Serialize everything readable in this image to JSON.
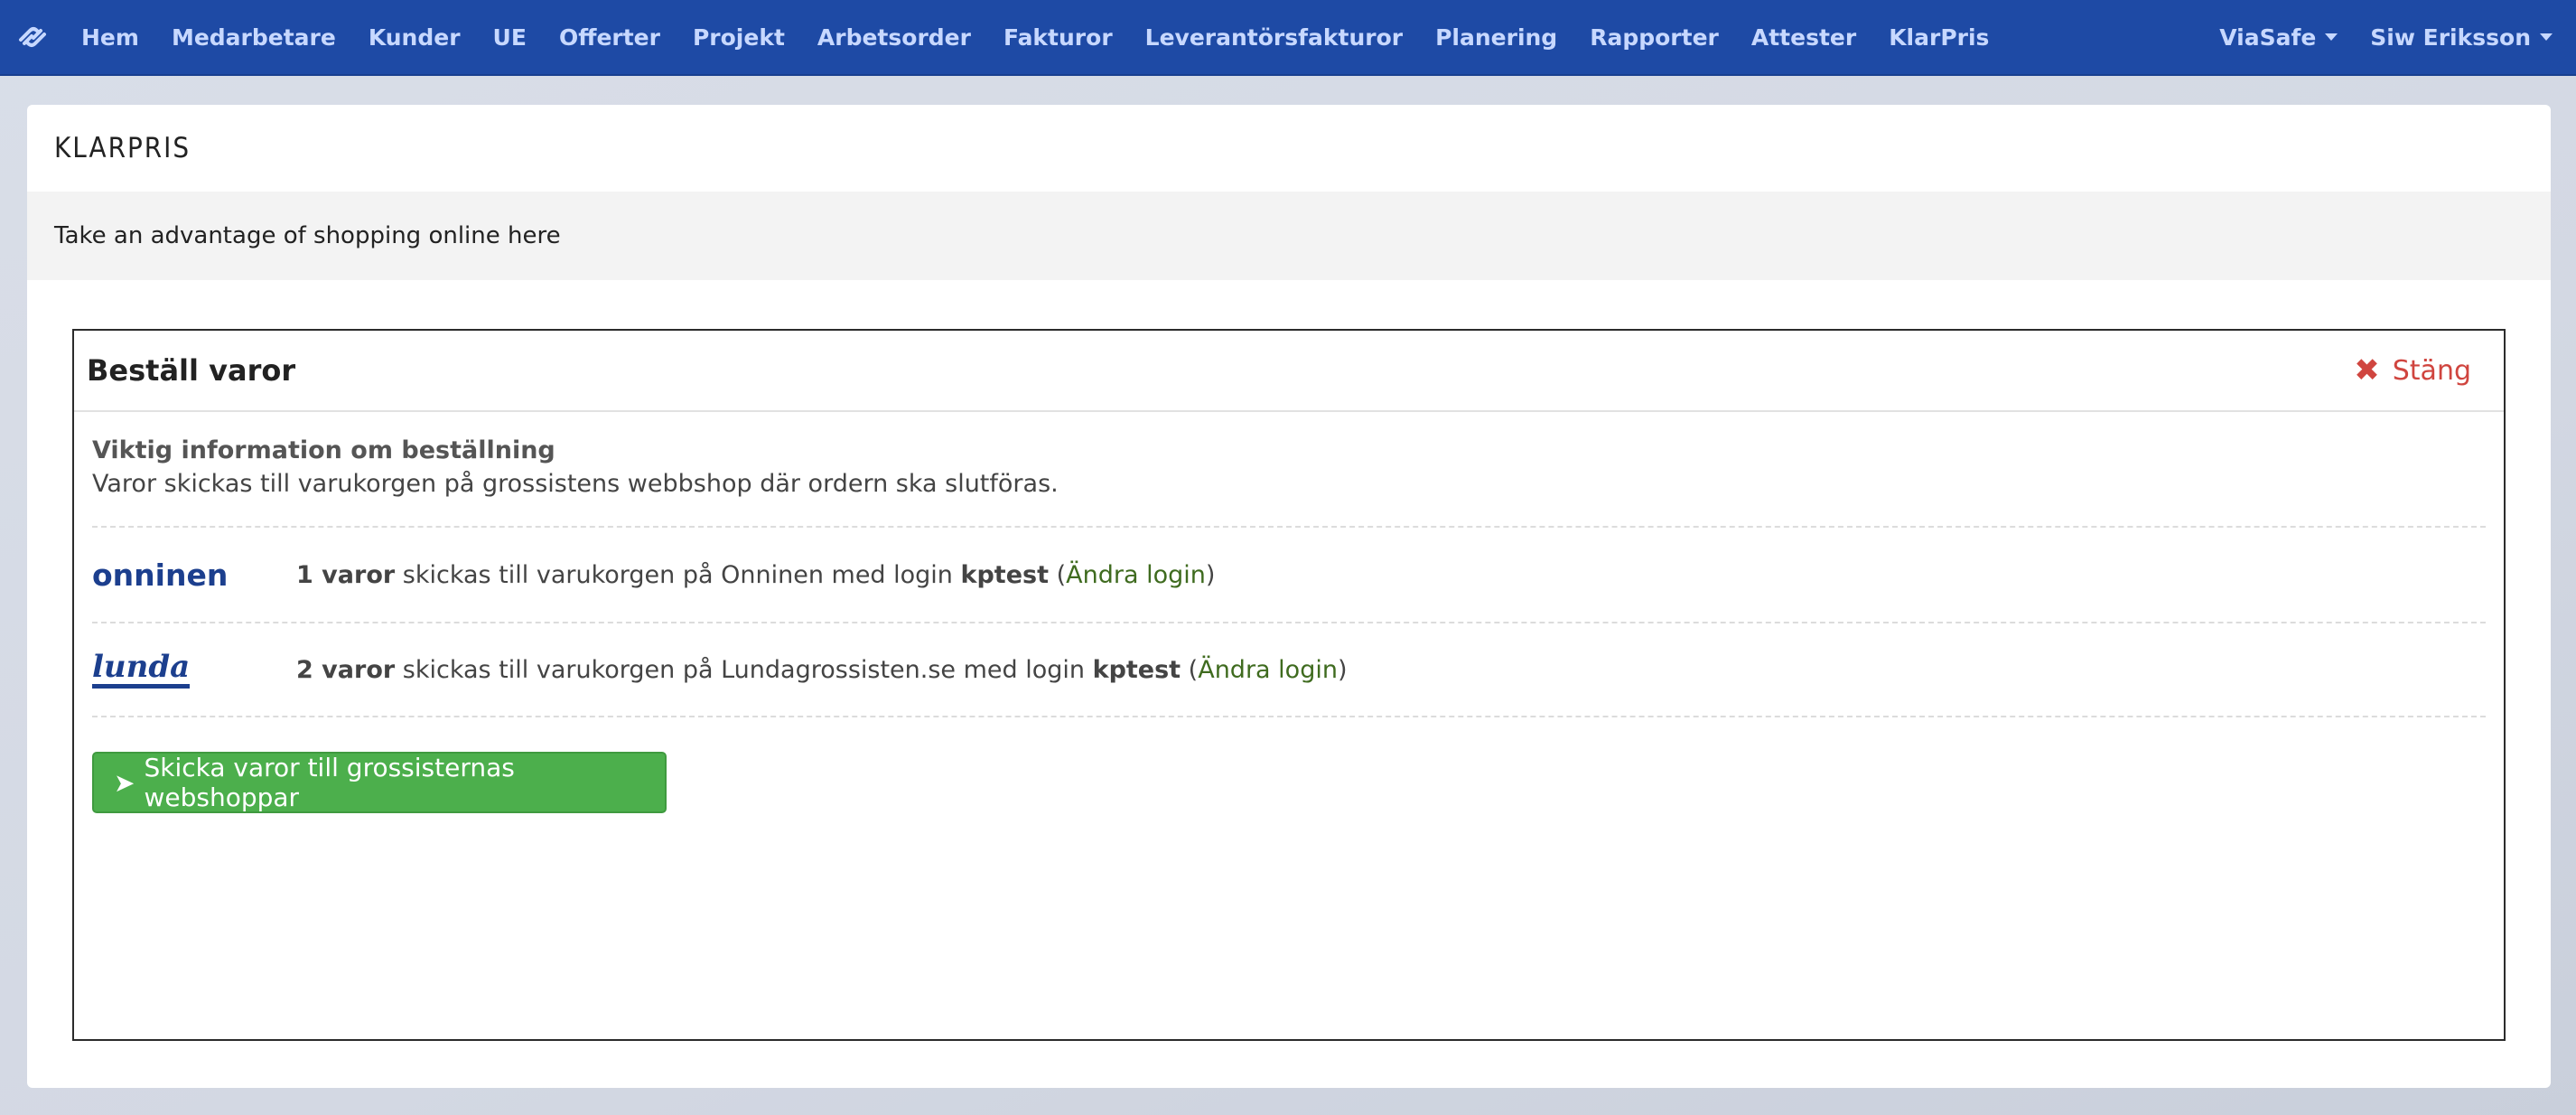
{
  "nav": {
    "logo_icon": "link-logo-icon",
    "items": [
      "Hem",
      "Medarbetare",
      "Kunder",
      "UE",
      "Offerter",
      "Projekt",
      "Arbetsorder",
      "Fakturor",
      "Leverantörsfakturor",
      "Planering",
      "Rapporter",
      "Attester",
      "KlarPris"
    ],
    "right": [
      "ViaSafe",
      "Siw Eriksson"
    ]
  },
  "panel": {
    "title": "KLARPRIS",
    "subtitle": "Take an advantage of shopping online here"
  },
  "order": {
    "title": "Beställ varor",
    "close_label": "Stäng",
    "close_icon": "close-x-icon",
    "info_title": "Viktig information om beställning",
    "info_text": "Varor skickas till varukorgen på grossistens webbshop där ordern ska slutföras.",
    "vendors": [
      {
        "logo_text": "onninen",
        "count": "1 varor",
        "pre": " skickas till varukorgen på Onninen med login ",
        "login": "kptest",
        "paren_open": " (",
        "link": "Ändra login",
        "paren_close": ")"
      },
      {
        "logo_text": "lunda",
        "count": "2 varor",
        "pre": " skickas till varukorgen på Lundagrossisten.se med login ",
        "login": "kptest",
        "paren_open": " (",
        "link": "Ändra login",
        "paren_close": ")"
      }
    ],
    "send_label": "Skicka varor till grossisternas webshoppar",
    "send_icon": "paper-plane-icon"
  },
  "colors": {
    "navbar": "#1e4aa5",
    "nav_text": "#c7d8ff",
    "close_red": "#d0453f",
    "button_green": "#4caf4c",
    "link_green": "#3f6b1f"
  }
}
